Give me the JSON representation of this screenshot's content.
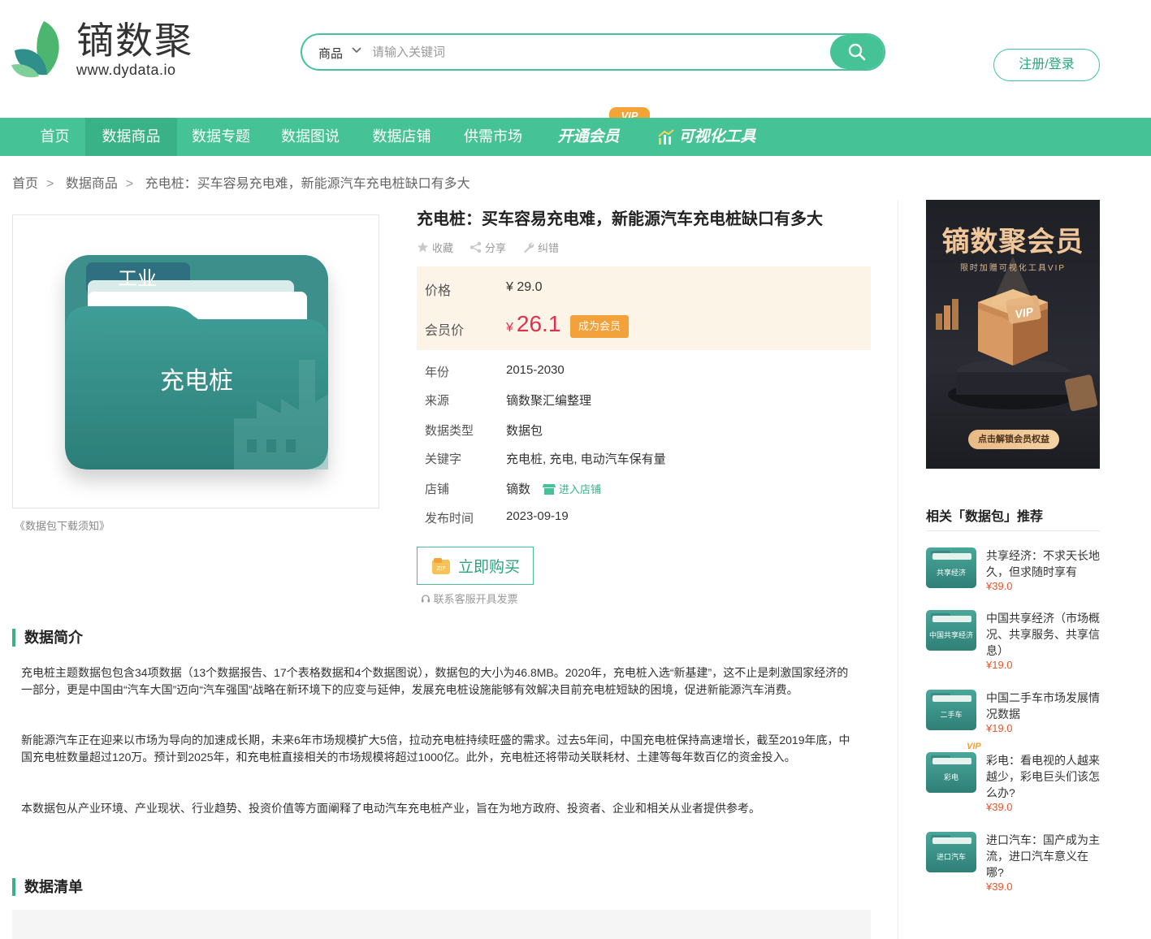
{
  "brand": {
    "name": "镝数聚",
    "url": "www.dydata.io"
  },
  "search": {
    "category": "商品",
    "placeholder": "请输入关键词"
  },
  "header": {
    "login_label": "注册/登录"
  },
  "nav": {
    "items": [
      "首页",
      "数据商品",
      "数据专题",
      "数据图说",
      "数据店铺",
      "供需市场"
    ],
    "vip_label": "开通会员",
    "vip_tag": "VIP",
    "viz_label": "可视化工具"
  },
  "breadcrumb": [
    "首页",
    "数据商品",
    "充电桩：买车容易充电难，新能源汽车充电桩缺口有多大"
  ],
  "cover": {
    "tab_label": "工业",
    "main_label": "充电桩"
  },
  "notice": "《数据包下载须知》",
  "product": {
    "title": "充电桩：买车容易充电难，新能源汽车充电桩缺口有多大",
    "actions": [
      "收藏",
      "分享",
      "纠错"
    ],
    "price_label": "价格",
    "price": "¥ 29.0",
    "member_label": "会员价",
    "member_currency": "¥",
    "member_price": "26.1",
    "become_member": "成为会员",
    "attrs": [
      {
        "label": "年份",
        "value": "2015-2030"
      },
      {
        "label": "来源",
        "value": "镝数聚汇编整理"
      },
      {
        "label": "数据类型",
        "value": "数据包"
      },
      {
        "label": "关键字",
        "value": "充电桩, 充电, 电动汽车保有量"
      },
      {
        "label": "店铺",
        "value": "镝数"
      },
      {
        "label": "发布时间",
        "value": "2023-09-19"
      }
    ],
    "enter_shop": "进入店铺",
    "buy_label": "立即购买",
    "invoice": "联系客服开具发票"
  },
  "intro": {
    "title": "数据简介",
    "paragraphs": [
      "充电桩主题数据包包含34项数据（13个数据报告、17个表格数据和4个数据图说），数据包的大小为46.8MB。2020年，充电桩入选“新基建”，这不止是刺激国家经济的一部分，更是中国由“汽车大国”迈向“汽车强国”战略在新环境下的应变与延伸，发展充电桩设施能够有效解决目前充电桩短缺的困境，促进新能源汽车消费。",
      "新能源汽车正在迎来以市场为导向的加速成长期，未来6年市场规模扩大5倍，拉动充电桩持续旺盛的需求。过去5年间，中国充电桩保持高速增长，截至2019年底，中国充电桩数量超过120万。预计到2025年，和充电桩直接相关的市场规模将超过1000亿。此外，充电桩还将带动关联耗材、土建等每年数百亿的资金投入。",
      "本数据包从产业环境、产业现状、行业趋势、投资价值等方面阐释了电动汽车充电桩产业，旨在为地方政府、投资者、企业和相关从业者提供参考。"
    ]
  },
  "list_section": {
    "title": "数据清单"
  },
  "ad": {
    "title": "镝数聚会员",
    "subtitle": "限时加赠可视化工具VIP",
    "button": "点击解锁会员权益",
    "badge": "VIP"
  },
  "recommend": {
    "title": "相关「数据包」推荐",
    "items": [
      {
        "thumb": "共享经济",
        "name": "共享经济：不求天长地久，但求随时享有",
        "price": "¥39.0"
      },
      {
        "thumb": "中国共享经济",
        "name": "中国共享经济（市场概况、共享服务、共享信息）",
        "price": "¥19.0"
      },
      {
        "thumb": "二手车",
        "name": "中国二手车市场发展情况数据",
        "price": "¥19.0"
      },
      {
        "thumb": "彩电",
        "name": "彩电：看电视的人越来越少，彩电巨头们该怎么办?",
        "price": "¥39.0",
        "vip": "VIP"
      },
      {
        "thumb": "进口汽车",
        "name": "进口汽车：国产成为主流，进口汽车意义在哪?",
        "price": "¥39.0"
      }
    ]
  }
}
